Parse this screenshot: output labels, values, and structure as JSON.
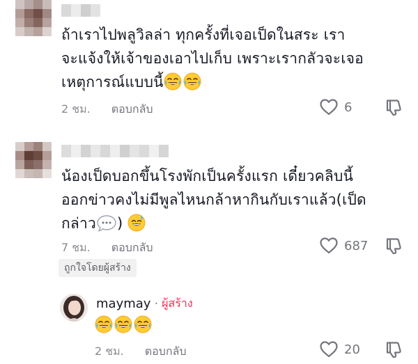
{
  "comments": [
    {
      "text_lines": [
        "ถ้าเราไปพลูวิลล่า ทุกครั้งที่เจอเป็ดในสระ เรา",
        "จะแจ้งให้เจ้าของเอาไปเก็บ เพราะเรากลัวจะเจอ",
        "เหตุการณ์แบบนี้"
      ],
      "emojis": [
        "joy-emoji",
        "joy-emoji"
      ],
      "time": "2 ชม.",
      "reply_label": "ตอบกลับ",
      "likes": "6"
    },
    {
      "text_lines": [
        "น้องเป็ดบอกขึ้นโรงพักเป็นครั้งแรก เดี๋ยวคลิบนี้",
        "ออกข่าวคงไม่มีพูลไหนกล้าหากินกับเราแล้ว(เป็ด",
        "กล่าว",
        ")"
      ],
      "time": "7 ชม.",
      "reply_label": "ตอบกลับ",
      "likes": "687",
      "creator_liked": "ถูกใจโดยผู้สร้าง"
    }
  ],
  "reply": {
    "username": "maymay",
    "separator": "·",
    "creator_label": "ผู้สร้าง",
    "emojis": [
      "joy-emoji",
      "joy-emoji",
      "joy-emoji"
    ],
    "time": "2 ชม.",
    "reply_label": "ตอบกลับ",
    "likes": "20"
  },
  "colors": {
    "creator": "#fe2c55",
    "meta": "#8a8b91",
    "text": "#161823"
  }
}
